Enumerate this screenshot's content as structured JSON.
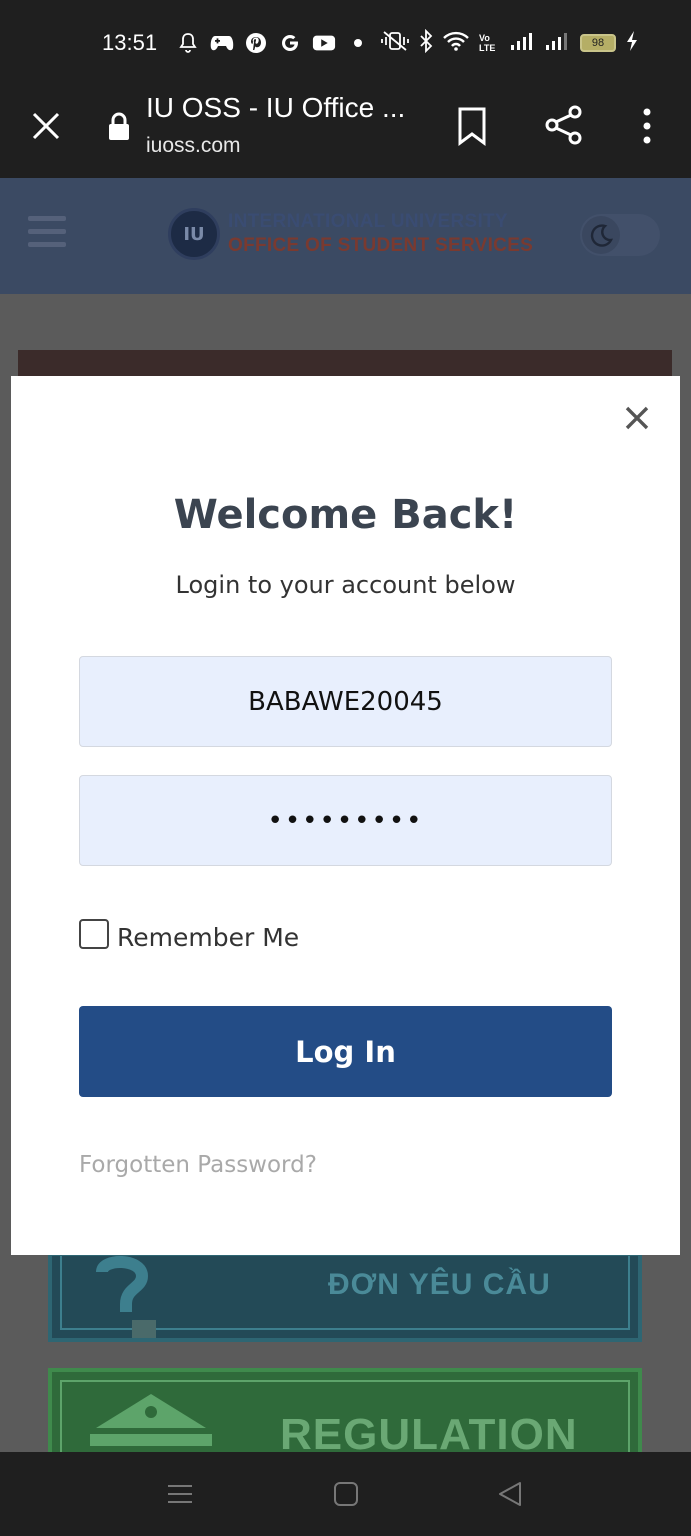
{
  "status_bar": {
    "time": "13:51",
    "icons": [
      "notification-bell-icon",
      "gamepad-icon",
      "pinterest-icon",
      "google-icon",
      "youtube-icon",
      "dot-icon"
    ],
    "right_icons": [
      "vibrate-icon",
      "bluetooth-icon",
      "wifi-icon",
      "volte-icon",
      "signal-icon",
      "signal-icon"
    ],
    "volte_label": "Vo LTE",
    "battery": "98"
  },
  "browser": {
    "title": "IU OSS - IU Office ...",
    "url": "iuoss.com"
  },
  "site": {
    "logo_line1": "INTERNATIONAL UNIVERSITY",
    "logo_line2": "OFFICE OF STUDENT SERVICES",
    "card_request_label": "ĐƠN YÊU CẦU",
    "card_regulation_label": "REGULATION"
  },
  "modal": {
    "title": "Welcome Back!",
    "subtitle": "Login to your account below",
    "username_value": "BABAWE20045",
    "password_value": "•••••••••",
    "remember_label": "Remember Me",
    "login_label": "Log In",
    "forgot_label": "Forgotten Password?"
  },
  "colors": {
    "login_button": "#234c86",
    "input_bg": "#e8effd",
    "modal_bg": "#ffffff",
    "overlay_bg": "#5b5b5b"
  }
}
